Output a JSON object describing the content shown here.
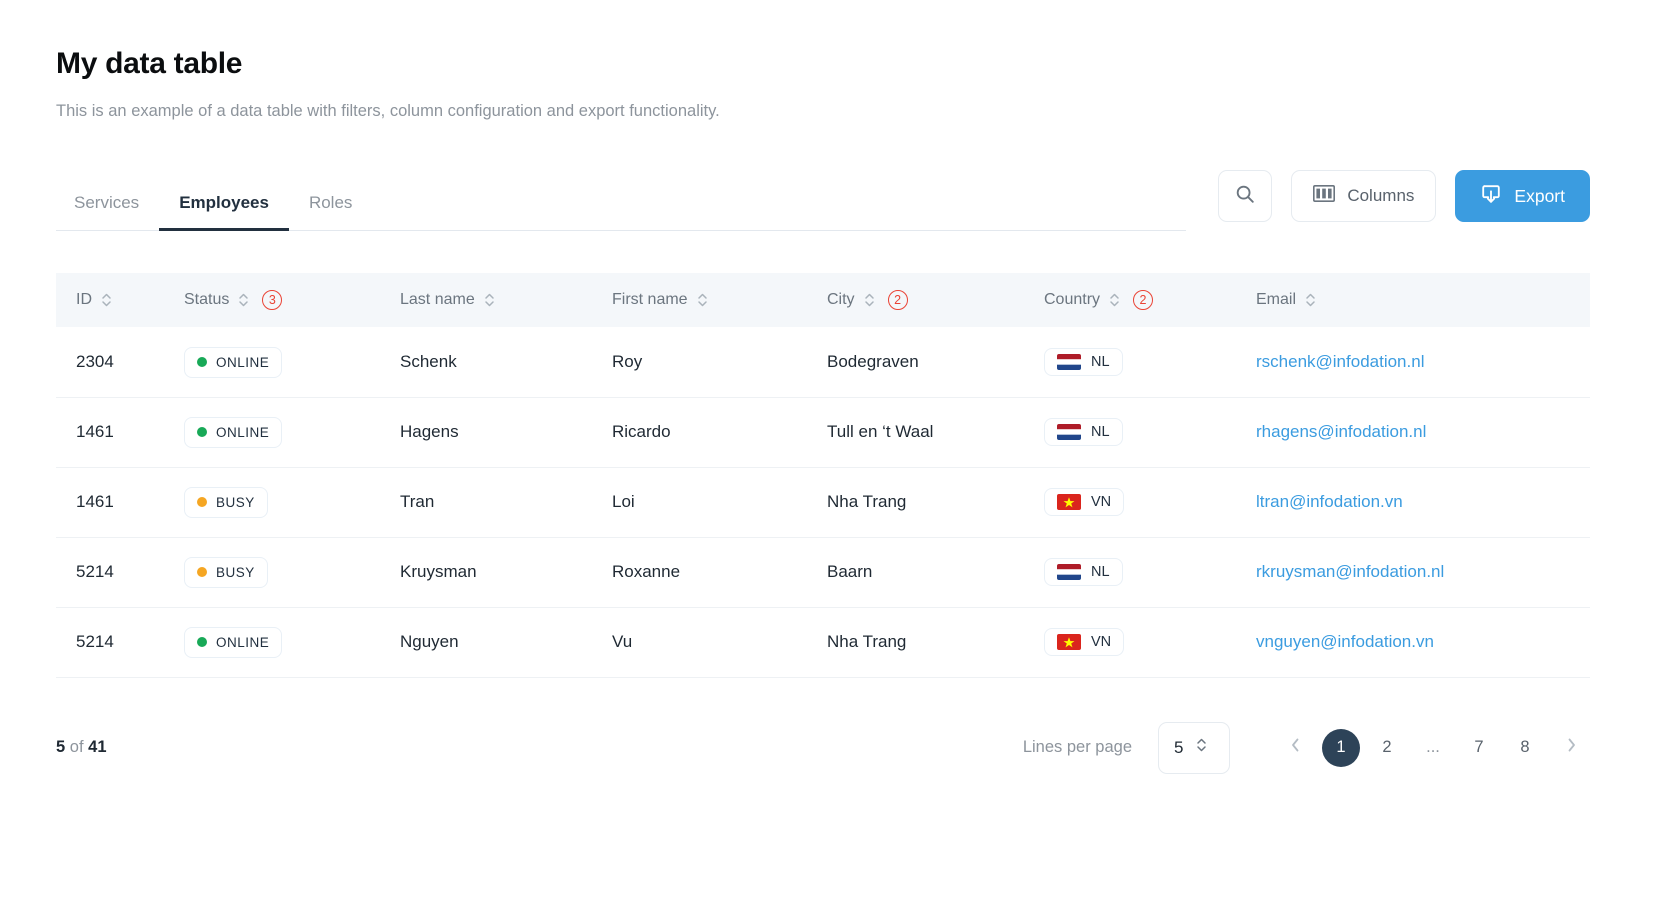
{
  "header": {
    "title": "My data table",
    "subtitle": "This is an example of a data table with filters, column configuration and export functionality."
  },
  "toolbar": {
    "tabs": [
      {
        "label": "Services",
        "active": false
      },
      {
        "label": "Employees",
        "active": true
      },
      {
        "label": "Roles",
        "active": false
      }
    ],
    "search_label": "",
    "columns_label": "Columns",
    "export_label": "Export",
    "accent_color": "#3b9ce0"
  },
  "table": {
    "columns": [
      {
        "label": "ID",
        "sortable": true,
        "filter_count": null
      },
      {
        "label": "Status",
        "sortable": true,
        "filter_count": "3"
      },
      {
        "label": "Last name",
        "sortable": true,
        "filter_count": null
      },
      {
        "label": "First name",
        "sortable": true,
        "filter_count": null
      },
      {
        "label": "City",
        "sortable": true,
        "filter_count": "2"
      },
      {
        "label": "Country",
        "sortable": true,
        "filter_count": "2"
      },
      {
        "label": "Email",
        "sortable": true,
        "filter_count": null
      }
    ],
    "rows": [
      {
        "id": "2304",
        "status": "ONLINE",
        "status_color": "#18a957",
        "last_name": "Schenk",
        "first_name": "Roy",
        "city": "Bodegraven",
        "country_code": "NL",
        "country_flag": "netherlands-flag",
        "email": "rschenk@infodation.nl"
      },
      {
        "id": "1461",
        "status": "ONLINE",
        "status_color": "#18a957",
        "last_name": "Hagens",
        "first_name": "Ricardo",
        "city": "Tull en ‘t Waal",
        "country_code": "NL",
        "country_flag": "netherlands-flag",
        "email": "rhagens@infodation.nl"
      },
      {
        "id": "1461",
        "status": "BUSY",
        "status_color": "#f5a623",
        "last_name": "Tran",
        "first_name": "Loi",
        "city": "Nha Trang",
        "country_code": "VN",
        "country_flag": "vietnam-flag",
        "email": "ltran@infodation.vn"
      },
      {
        "id": "5214",
        "status": "BUSY",
        "status_color": "#f5a623",
        "last_name": "Kruysman",
        "first_name": "Roxanne",
        "city": "Baarn",
        "country_code": "NL",
        "country_flag": "netherlands-flag",
        "email": "rkruysman@infodation.nl"
      },
      {
        "id": "5214",
        "status": "ONLINE",
        "status_color": "#18a957",
        "last_name": "Nguyen",
        "first_name": "Vu",
        "city": "Nha Trang",
        "country_code": "VN",
        "country_flag": "vietnam-flag",
        "email": "vnguyen@infodation.vn"
      }
    ]
  },
  "footer": {
    "shown_count": "5",
    "of_label": "of",
    "total_count": "41",
    "lines_per_page_label": "Lines per page",
    "lines_per_page_value": "5",
    "pages": [
      {
        "label": "1",
        "active": true
      },
      {
        "label": "2",
        "active": false
      },
      {
        "label": "...",
        "active": false,
        "ellipsis": true
      },
      {
        "label": "7",
        "active": false
      },
      {
        "label": "8",
        "active": false
      }
    ],
    "prev_icon": "chevron-left-icon",
    "next_icon": "chevron-right-icon"
  }
}
